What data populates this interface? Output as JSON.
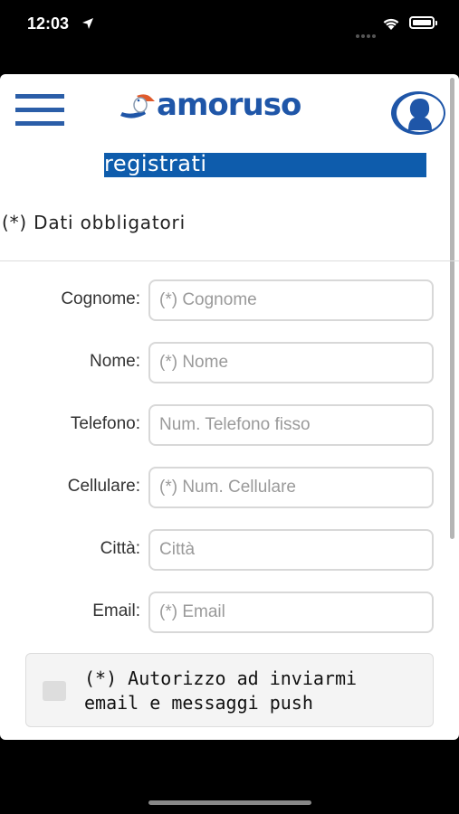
{
  "status_bar": {
    "time": "12:03",
    "location_icon": "location-arrow-icon",
    "wifi_icon": "wifi-icon",
    "battery_icon": "battery-icon",
    "battery_level": 1.0
  },
  "header": {
    "menu_icon": "hamburger-menu-icon",
    "brand": "amoruso",
    "brand_color": "#1f56a8",
    "profile_icon": "user-profile-icon"
  },
  "page": {
    "title": "registrati",
    "title_bg": "#0e5cac",
    "required_note": "(*) Dati obbligatori"
  },
  "form": {
    "fields": [
      {
        "label": "Cognome:",
        "placeholder": "(*) Cognome",
        "value": ""
      },
      {
        "label": "Nome:",
        "placeholder": "(*) Nome",
        "value": ""
      },
      {
        "label": "Telefono:",
        "placeholder": "Num. Telefono fisso",
        "value": ""
      },
      {
        "label": "Cellulare:",
        "placeholder": "(*) Num. Cellulare",
        "value": ""
      },
      {
        "label": "Città:",
        "placeholder": "Città",
        "value": ""
      },
      {
        "label": "Email:",
        "placeholder": "(*) Email",
        "value": ""
      }
    ],
    "consent": {
      "text": "(*) Autorizzo ad inviarmi email e messaggi push",
      "checked": false
    }
  }
}
